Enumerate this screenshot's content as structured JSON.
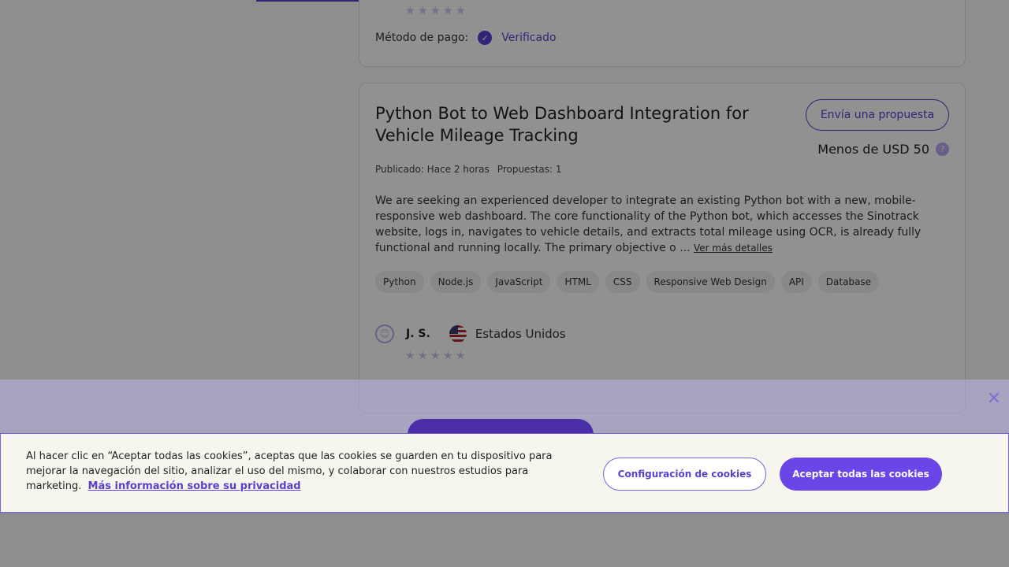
{
  "previous_card": {
    "payment_label": "Método de pago:",
    "payment_status": "Verificado"
  },
  "job": {
    "title": "Python Bot to Web Dashboard Integration for Vehicle Mileage Tracking",
    "proposal_button": "Envía una propuesta",
    "budget": "Menos de USD 50",
    "published": "Publicado: Hace 2 horas",
    "proposals": "Propuestas: 1",
    "description": "We are seeking an experienced developer to integrate an existing Python bot with a new, mobile-responsive web dashboard. The core functionality of the Python bot, which accesses the Sinotrack website, logs in, navigates to vehicle details, and extracts total mileage using OCR, is already fully functional and running locally. The primary objective o ...",
    "more_link": "Ver más detalles",
    "tags": [
      "Python",
      "Node.js",
      "JavaScript",
      "HTML",
      "CSS",
      "Responsive Web Design",
      "API",
      "Database"
    ],
    "client": {
      "name": "J. S.",
      "country": "Estados Unidos",
      "rating": 0
    }
  },
  "cookie_banner": {
    "text": "Al hacer clic en “Aceptar todas las cookies”, aceptas que las cookies se guarden en tu dispositivo para mejorar la navegación del sitio, analizar el uso del mismo, y colaborar con nuestros estudios para marketing.",
    "privacy_link": "Más información sobre su privacidad",
    "settings_button": "Configuración de cookies",
    "accept_button": "Aceptar todas las cookies",
    "close_glyph": "✕"
  },
  "colors": {
    "accent": "#5b3fd1",
    "accent_button": "#6a45e8"
  }
}
